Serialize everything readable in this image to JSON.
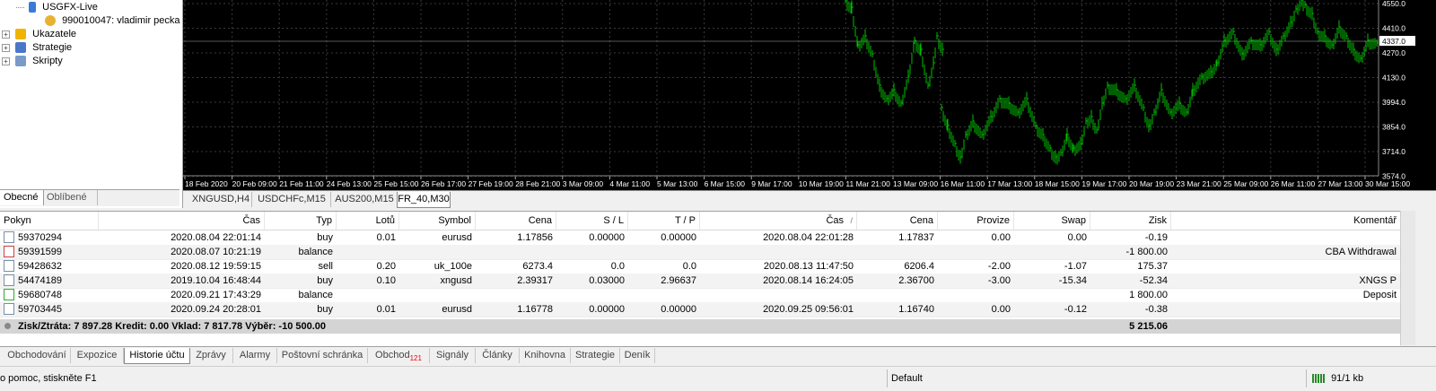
{
  "navigator": {
    "account_server": "USGFX-Live",
    "account_user": "990010047: vladimir pecka",
    "items": [
      {
        "label": "Ukazatele"
      },
      {
        "label": "Strategie"
      },
      {
        "label": "Skripty"
      }
    ],
    "tabs": [
      {
        "label": "Obecné",
        "active": true
      },
      {
        "label": "Oblíbené",
        "active": false
      }
    ]
  },
  "chart": {
    "price_labels": [
      "4550.0",
      "4410.0",
      "4270.0",
      "4130.0",
      "3994.0",
      "3854.0",
      "3714.0",
      "3574.0"
    ],
    "current_price": "4337.0",
    "time_labels": [
      "18 Feb 2020",
      "20 Feb 09:00",
      "21 Feb 11:00",
      "24 Feb 13:00",
      "25 Feb 15:00",
      "26 Feb 17:00",
      "27 Feb 19:00",
      "28 Feb 21:00",
      "3 Mar 09:00",
      "4 Mar 11:00",
      "5 Mar 13:00",
      "6 Mar 15:00",
      "9 Mar 17:00",
      "10 Mar 19:00",
      "11 Mar 21:00",
      "13 Mar 09:00",
      "16 Mar 11:00",
      "17 Mar 13:00",
      "18 Mar 15:00",
      "19 Mar 17:00",
      "20 Mar 19:00",
      "23 Mar 21:00",
      "25 Mar 09:00",
      "26 Mar 11:00",
      "27 Mar 13:00",
      "30 Mar 15:00"
    ],
    "colors": {
      "background": "#000000",
      "bars": "#00c000",
      "grid": "#3a3a3a",
      "text": "#ffffff"
    },
    "tabs": [
      {
        "label": "XNGUSD,H4",
        "active": false
      },
      {
        "label": "USDCHFc,M15",
        "active": false
      },
      {
        "label": "AUS200,M15",
        "active": false
      },
      {
        "label": "FR_40,M30",
        "active": true
      }
    ]
  },
  "table": {
    "headers": [
      "Pokyn",
      "Čas",
      "Typ",
      "Lotů",
      "Symbol",
      "Cena",
      "S / L",
      "T / P",
      "Čas",
      "Cena",
      "Provize",
      "Swap",
      "Zisk",
      "Komentář"
    ],
    "sort_indicator": "/",
    "rows": [
      {
        "icon": "buy-order-icon",
        "order": "59370294",
        "open_time": "2020.08.04 22:01:14",
        "type": "buy",
        "lots": "0.01",
        "symbol": "eurusd",
        "open_price": "1.17856",
        "sl": "0.00000",
        "tp": "0.00000",
        "close_time": "2020.08.04 22:01:28",
        "close_price": "1.17837",
        "commission": "0.00",
        "swap": "0.00",
        "profit": "-0.19",
        "comment": ""
      },
      {
        "icon": "balance-withdrawal-icon",
        "order": "59391599",
        "open_time": "2020.08.07 10:21:19",
        "type": "balance",
        "lots": "",
        "symbol": "",
        "open_price": "",
        "sl": "",
        "tp": "",
        "close_time": "",
        "close_price": "",
        "commission": "",
        "swap": "",
        "profit": "-1 800.00",
        "comment": "CBA Withdrawal"
      },
      {
        "icon": "sell-order-icon",
        "order": "59428632",
        "open_time": "2020.08.12 19:59:15",
        "type": "sell",
        "lots": "0.20",
        "symbol": "uk_100e",
        "open_price": "6273.4",
        "sl": "0.0",
        "tp": "0.0",
        "close_time": "2020.08.13 11:47:50",
        "close_price": "6206.4",
        "commission": "-2.00",
        "swap": "-1.07",
        "profit": "175.37",
        "comment": ""
      },
      {
        "icon": "buy-order-icon",
        "order": "54474189",
        "open_time": "2019.10.04 16:48:44",
        "type": "buy",
        "lots": "0.10",
        "symbol": "xngusd",
        "open_price": "2.39317",
        "sl": "0.03000",
        "tp": "2.96637",
        "close_time": "2020.08.14 16:24:05",
        "close_price": "2.36700",
        "commission": "-3.00",
        "swap": "-15.34",
        "profit": "-52.34",
        "comment": "XNGS P"
      },
      {
        "icon": "balance-deposit-icon",
        "order": "59680748",
        "open_time": "2020.09.21 17:43:29",
        "type": "balance",
        "lots": "",
        "symbol": "",
        "open_price": "",
        "sl": "",
        "tp": "",
        "close_time": "",
        "close_price": "",
        "commission": "",
        "swap": "",
        "profit": "1 800.00",
        "comment": "Deposit"
      },
      {
        "icon": "buy-order-icon",
        "order": "59703445",
        "open_time": "2020.09.24 20:28:01",
        "type": "buy",
        "lots": "0.01",
        "symbol": "eurusd",
        "open_price": "1.16778",
        "sl": "0.00000",
        "tp": "0.00000",
        "close_time": "2020.09.25 09:56:01",
        "close_price": "1.16740",
        "commission": "0.00",
        "swap": "-0.12",
        "profit": "-0.38",
        "comment": ""
      }
    ],
    "summary": {
      "text": "Zisk/Ztráta: 7 897.28  Kredit: 0.00  Vklad: 7 817.78  Výběr: -10 500.00",
      "total": "5 215.06"
    }
  },
  "terminal_tabs": [
    {
      "label": "Obchodování",
      "active": false,
      "badge": ""
    },
    {
      "label": "Expozice",
      "active": false,
      "badge": ""
    },
    {
      "label": "Historie účtu",
      "active": true,
      "badge": ""
    },
    {
      "label": "Zprávy",
      "active": false,
      "badge": ""
    },
    {
      "label": "Alarmy",
      "active": false,
      "badge": ""
    },
    {
      "label": "Poštovní schránka",
      "active": false,
      "badge": ""
    },
    {
      "label": "Obchod",
      "active": false,
      "badge": "121"
    },
    {
      "label": "Signály",
      "active": false,
      "badge": ""
    },
    {
      "label": "Články",
      "active": false,
      "badge": ""
    },
    {
      "label": "Knihovna",
      "active": false,
      "badge": ""
    },
    {
      "label": "Strategie",
      "active": false,
      "badge": ""
    },
    {
      "label": "Deník",
      "active": false,
      "badge": ""
    }
  ],
  "statusbar": {
    "help": "o pomoc, stiskněte F1",
    "profile": "Default",
    "traffic": "91/1 kb"
  }
}
